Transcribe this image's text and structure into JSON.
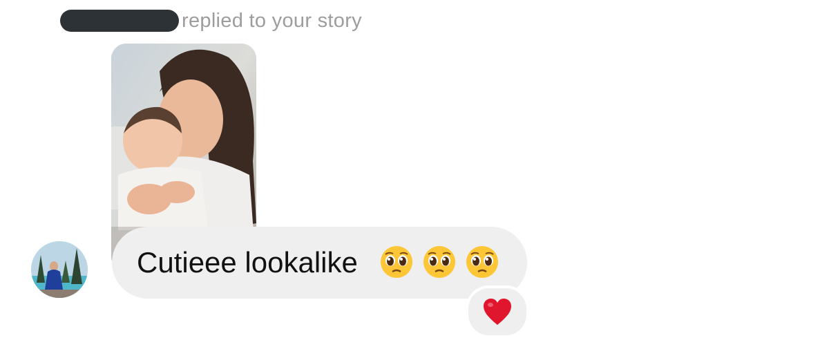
{
  "header": {
    "reply_label": "replied to your story"
  },
  "message": {
    "text": "Cutieee lookalike",
    "emojis": [
      "pleading-face-emoji",
      "pleading-face-emoji",
      "pleading-face-emoji"
    ]
  },
  "reaction": {
    "icon": "red-heart-icon"
  },
  "colors": {
    "bubble": "#efefef",
    "muted_text": "#9d9d9d",
    "redaction": "#2d3236",
    "heart": "#e0152e"
  }
}
